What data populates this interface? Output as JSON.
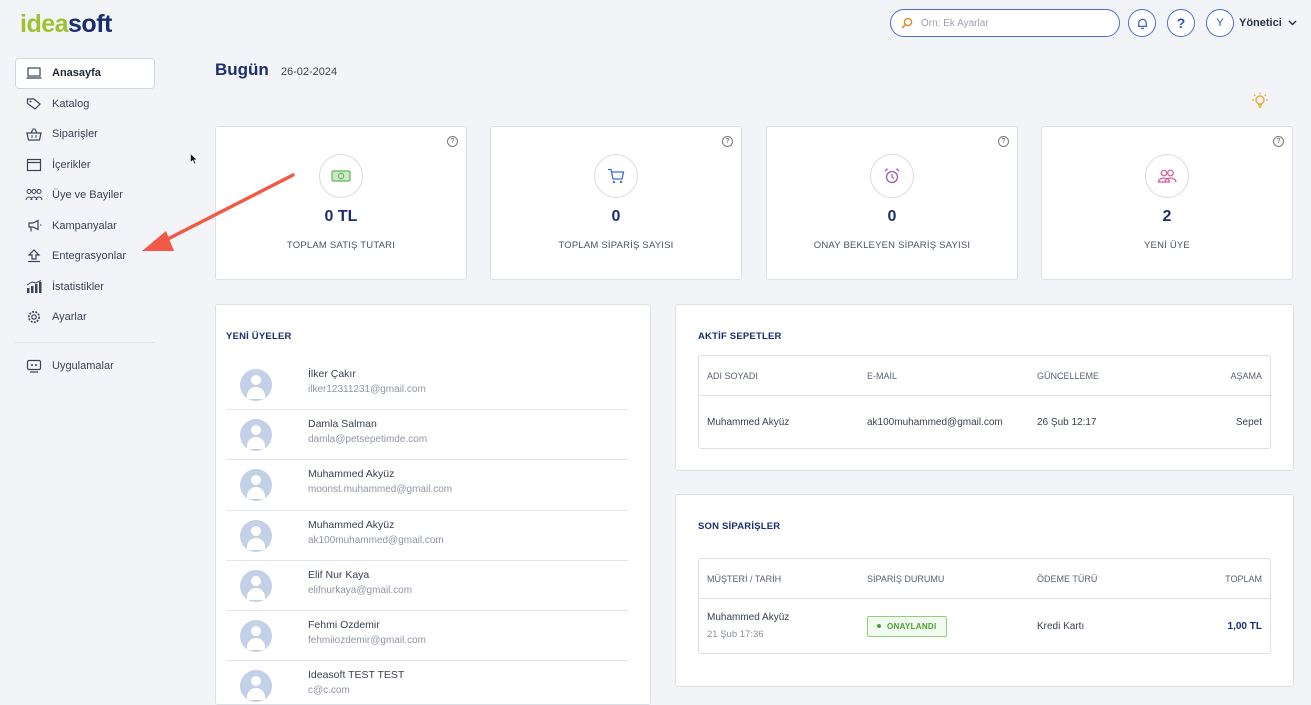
{
  "header": {
    "logo_part1": "idea",
    "logo_part2": "soft",
    "search_placeholder": "Örn: Ek Ayarlar",
    "avatar_letter": "Y",
    "user_name": "Yönetici",
    "help_label": "?"
  },
  "sidebar": {
    "items": [
      {
        "label": "Anasayfa",
        "icon": "laptop-icon"
      },
      {
        "label": "Katalog",
        "icon": "tag-icon"
      },
      {
        "label": "Siparişler",
        "icon": "basket-icon"
      },
      {
        "label": "İçerikler",
        "icon": "window-icon"
      },
      {
        "label": "Üye ve Bayiler",
        "icon": "users-icon"
      },
      {
        "label": "Kampanyalar",
        "icon": "megaphone-icon"
      },
      {
        "label": "Entegrasyonlar",
        "icon": "upload-icon"
      },
      {
        "label": "İstatistikler",
        "icon": "chart-icon"
      },
      {
        "label": "Ayarlar",
        "icon": "gear-icon"
      }
    ],
    "apps_label": "Uygulamalar"
  },
  "page": {
    "title": "Bugün",
    "date": "26-02-2024"
  },
  "stats": [
    {
      "value": "0 TL",
      "label": "TOPLAM SATIŞ TUTARI",
      "icon": "money-icon",
      "color": "#5cb85c"
    },
    {
      "value": "0",
      "label": "TOPLAM SİPARİŞ SAYISI",
      "icon": "cart-icon",
      "color": "#3b6fd6"
    },
    {
      "value": "0",
      "label": "ONAY BEKLEYEN SİPARİŞ SAYISI",
      "icon": "alarm-icon",
      "color": "#9b59b6"
    },
    {
      "value": "2",
      "label": "YENİ ÜYE",
      "icon": "users-icon",
      "color": "#d8589c"
    }
  ],
  "new_members": {
    "title": "YENİ ÜYELER",
    "items": [
      {
        "name": "İlker Çakır",
        "email": "ilker12311231@gmail.com"
      },
      {
        "name": "Damla Salman",
        "email": "damla@petsepetimde.com"
      },
      {
        "name": "Muhammed Akyüz",
        "email": "moonst.muhammed@gmail.com"
      },
      {
        "name": "Muhammed Akyüz",
        "email": "ak100muhammed@gmail.com"
      },
      {
        "name": "Elif Nur Kaya",
        "email": "elifnurkaya@gmail.com"
      },
      {
        "name": "Fehmi Ozdemir",
        "email": "fehmiiozdemir@gmail.com"
      },
      {
        "name": "Ideasoft TEST TEST",
        "email": "c@c.com"
      }
    ]
  },
  "active_carts": {
    "title": "AKTİF SEPETLER",
    "headers": [
      "ADI SOYADI",
      "E-MAİL",
      "GÜNCELLEME",
      "AŞAMA"
    ],
    "rows": [
      {
        "name": "Muhammed Akyüz",
        "email": "ak100muhammed@gmail.com",
        "updated": "26 Şub 12:17",
        "stage": "Sepet"
      }
    ]
  },
  "recent_orders": {
    "title": "SON SİPARİŞLER",
    "headers": [
      "MÜŞTERİ / TARİH",
      "SİPARİŞ DURUMU",
      "ÖDEME TÜRÜ",
      "TOPLAM"
    ],
    "rows": [
      {
        "customer": "Muhammed Akyüz",
        "date": "21 Şub 17:36",
        "status": "ONAYLANDI",
        "payment": "Kredi Kartı",
        "total": "1,00 TL"
      }
    ]
  },
  "colors": {
    "brand_navy": "#1c2e6f",
    "brand_green": "#9fc12f",
    "accent_blue": "#4a6dd8",
    "annotation_arrow": "#f05a47"
  }
}
